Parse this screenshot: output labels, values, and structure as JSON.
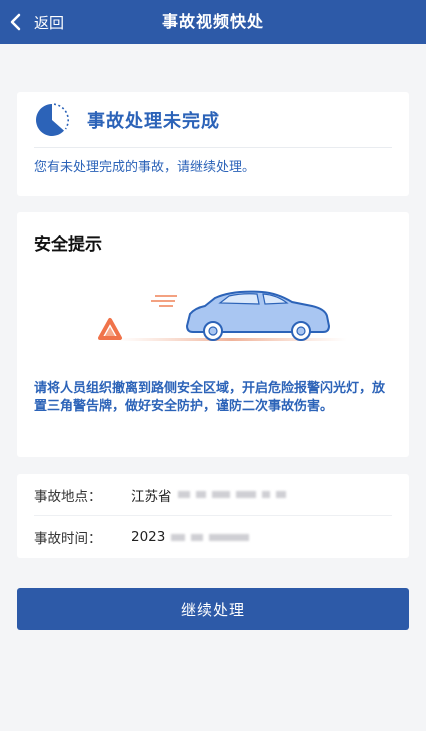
{
  "nav": {
    "back_label": "返回",
    "title": "事故视频快处"
  },
  "status": {
    "title": "事故处理未完成",
    "description": "您有未处理完成的事故，请继续处理。"
  },
  "safety": {
    "title": "安全提示",
    "text": "请将人员组织撤离到路侧安全区域，开启危险报警闪光灯，放置三角警告牌，做好安全防护，谨防二次事故伤害。"
  },
  "info": {
    "location_label": "事故地点：",
    "location_value": "江苏省",
    "time_label": "事故时间：",
    "time_value": "2023"
  },
  "actions": {
    "continue_label": "继续处理"
  },
  "colors": {
    "primary": "#2d5aa8",
    "accent_text": "#2c63b8",
    "warning": "#f0734a"
  },
  "icons": [
    "chevron-left-icon",
    "pie-status-icon",
    "warning-triangle-icon",
    "car-illustration"
  ]
}
